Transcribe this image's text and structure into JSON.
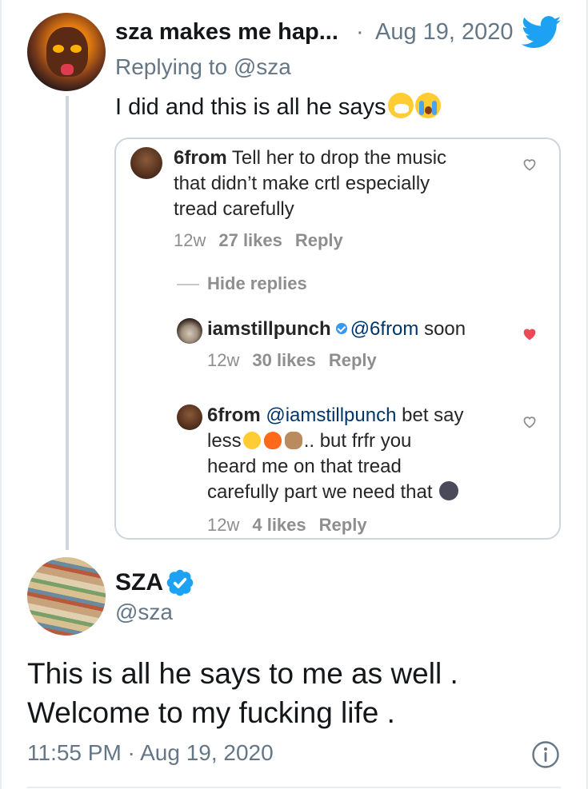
{
  "reply_tweet": {
    "author_name": "sza makes me hap...",
    "separator": "·",
    "date": "Aug 19, 2020",
    "replying_prefix": "Replying to",
    "replying_handle": "@sza",
    "text": "I did and this is all he says",
    "emojis": [
      "sneezing-face-emoji",
      "loudly-crying-face-emoji"
    ]
  },
  "instagram_comments": {
    "comment1": {
      "username": "6from",
      "line1_rest": " Tell her to drop the music",
      "line2": "that didn’t make crtl especially",
      "line3": "tread carefully",
      "time": "12w",
      "likes": "27 likes",
      "reply": "Reply"
    },
    "hide_replies": "Hide replies",
    "comment2": {
      "username": "iamstillpunch",
      "mention": "@6from",
      "text": " soon",
      "time": "12w",
      "likes": "30 likes",
      "reply": "Reply",
      "liked": true
    },
    "comment3": {
      "username": "6from",
      "mention": "@iamstillpunch",
      "line1_rest": " bet say",
      "line2_start": "less",
      "line2_end": ".. but frfr you",
      "line3": "heard me on that tread",
      "line4": "carefully part we need that",
      "time": "12w",
      "likes": "4 likes",
      "reply": "Reply"
    }
  },
  "main_tweet": {
    "author_name": "SZA",
    "handle": "@sza",
    "text_line1": "This is all he says to me as well .",
    "text_line2": "Welcome to my fucking life .",
    "timestamp": "11:55 PM · Aug 19, 2020"
  },
  "colors": {
    "twitter_blue": "#1da1f2",
    "secondary_text": "#657786",
    "ig_heart_red": "#ed4956"
  }
}
